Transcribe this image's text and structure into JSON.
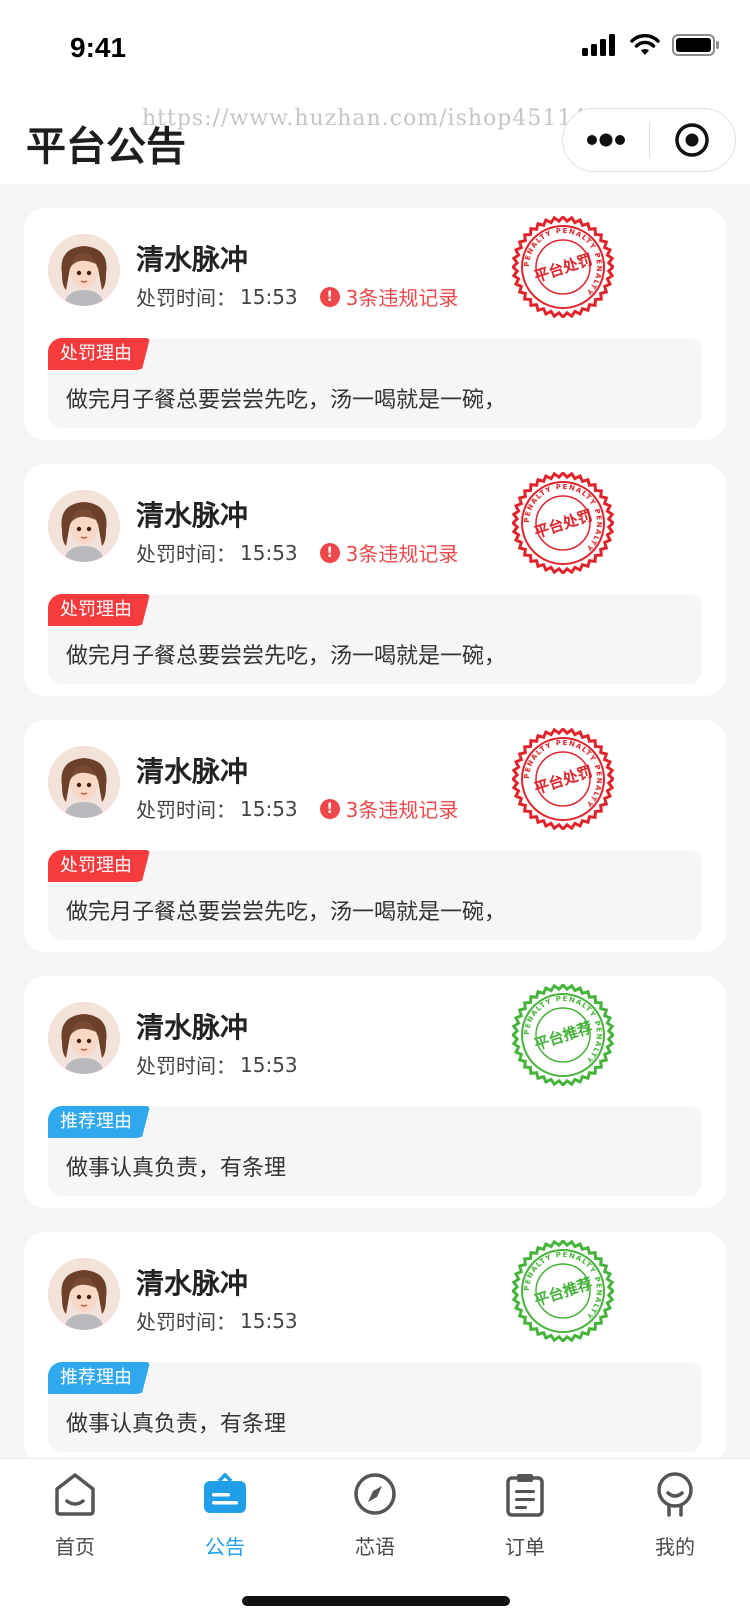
{
  "status_bar": {
    "time": "9:41"
  },
  "header": {
    "title": "平台公告",
    "watermark": "https://www.huzhan.com/ishop45114"
  },
  "cards": [
    {
      "name": "清水脉冲",
      "time_label": "处罚时间：",
      "time": "15:53",
      "violations": "3条违规记录",
      "stamp_type": "penalty",
      "stamp_text": "平台处罚",
      "stamp_ring": "PENALTY PENALTY PENALTY",
      "reason_label": "处罚理由",
      "reason": "做完月子餐总要尝尝先吃，汤一喝就是一碗，",
      "tag_color": "#f53b3b"
    },
    {
      "name": "清水脉冲",
      "time_label": "处罚时间：",
      "time": "15:53",
      "violations": "3条违规记录",
      "stamp_type": "penalty",
      "stamp_text": "平台处罚",
      "stamp_ring": "PENALTY PENALTY PENALTY",
      "reason_label": "处罚理由",
      "reason": "做完月子餐总要尝尝先吃，汤一喝就是一碗，",
      "tag_color": "#f53b3b"
    },
    {
      "name": "清水脉冲",
      "time_label": "处罚时间：",
      "time": "15:53",
      "violations": "3条违规记录",
      "stamp_type": "penalty",
      "stamp_text": "平台处罚",
      "stamp_ring": "PENALTY PENALTY PENALTY",
      "reason_label": "处罚理由",
      "reason": "做完月子餐总要尝尝先吃，汤一喝就是一碗，",
      "tag_color": "#f53b3b"
    },
    {
      "name": "清水脉冲",
      "time_label": "处罚时间：",
      "time": "15:53",
      "violations": "",
      "stamp_type": "recommend",
      "stamp_text": "平台推荐",
      "stamp_ring": "PENALTY PENALTY PENALTY",
      "reason_label": "推荐理由",
      "reason": "做事认真负责，有条理",
      "tag_color": "#2fa8ee"
    },
    {
      "name": "清水脉冲",
      "time_label": "处罚时间：",
      "time": "15:53",
      "violations": "",
      "stamp_type": "recommend",
      "stamp_text": "平台推荐",
      "stamp_ring": "PENALTY PENALTY PENALTY",
      "reason_label": "推荐理由",
      "reason": "做事认真负责，有条理",
      "tag_color": "#2fa8ee"
    }
  ],
  "tabbar": [
    {
      "label": "首页",
      "icon": "home-icon",
      "active": false
    },
    {
      "label": "公告",
      "icon": "announcement-icon",
      "active": true
    },
    {
      "label": "芯语",
      "icon": "compass-icon",
      "active": false
    },
    {
      "label": "订单",
      "icon": "clipboard-icon",
      "active": false
    },
    {
      "label": "我的",
      "icon": "profile-icon",
      "active": false
    }
  ],
  "colors": {
    "accent": "#1e9fe8",
    "penalty": "#e0242b",
    "recommend": "#46b33a",
    "background": "#f4f5f7"
  }
}
